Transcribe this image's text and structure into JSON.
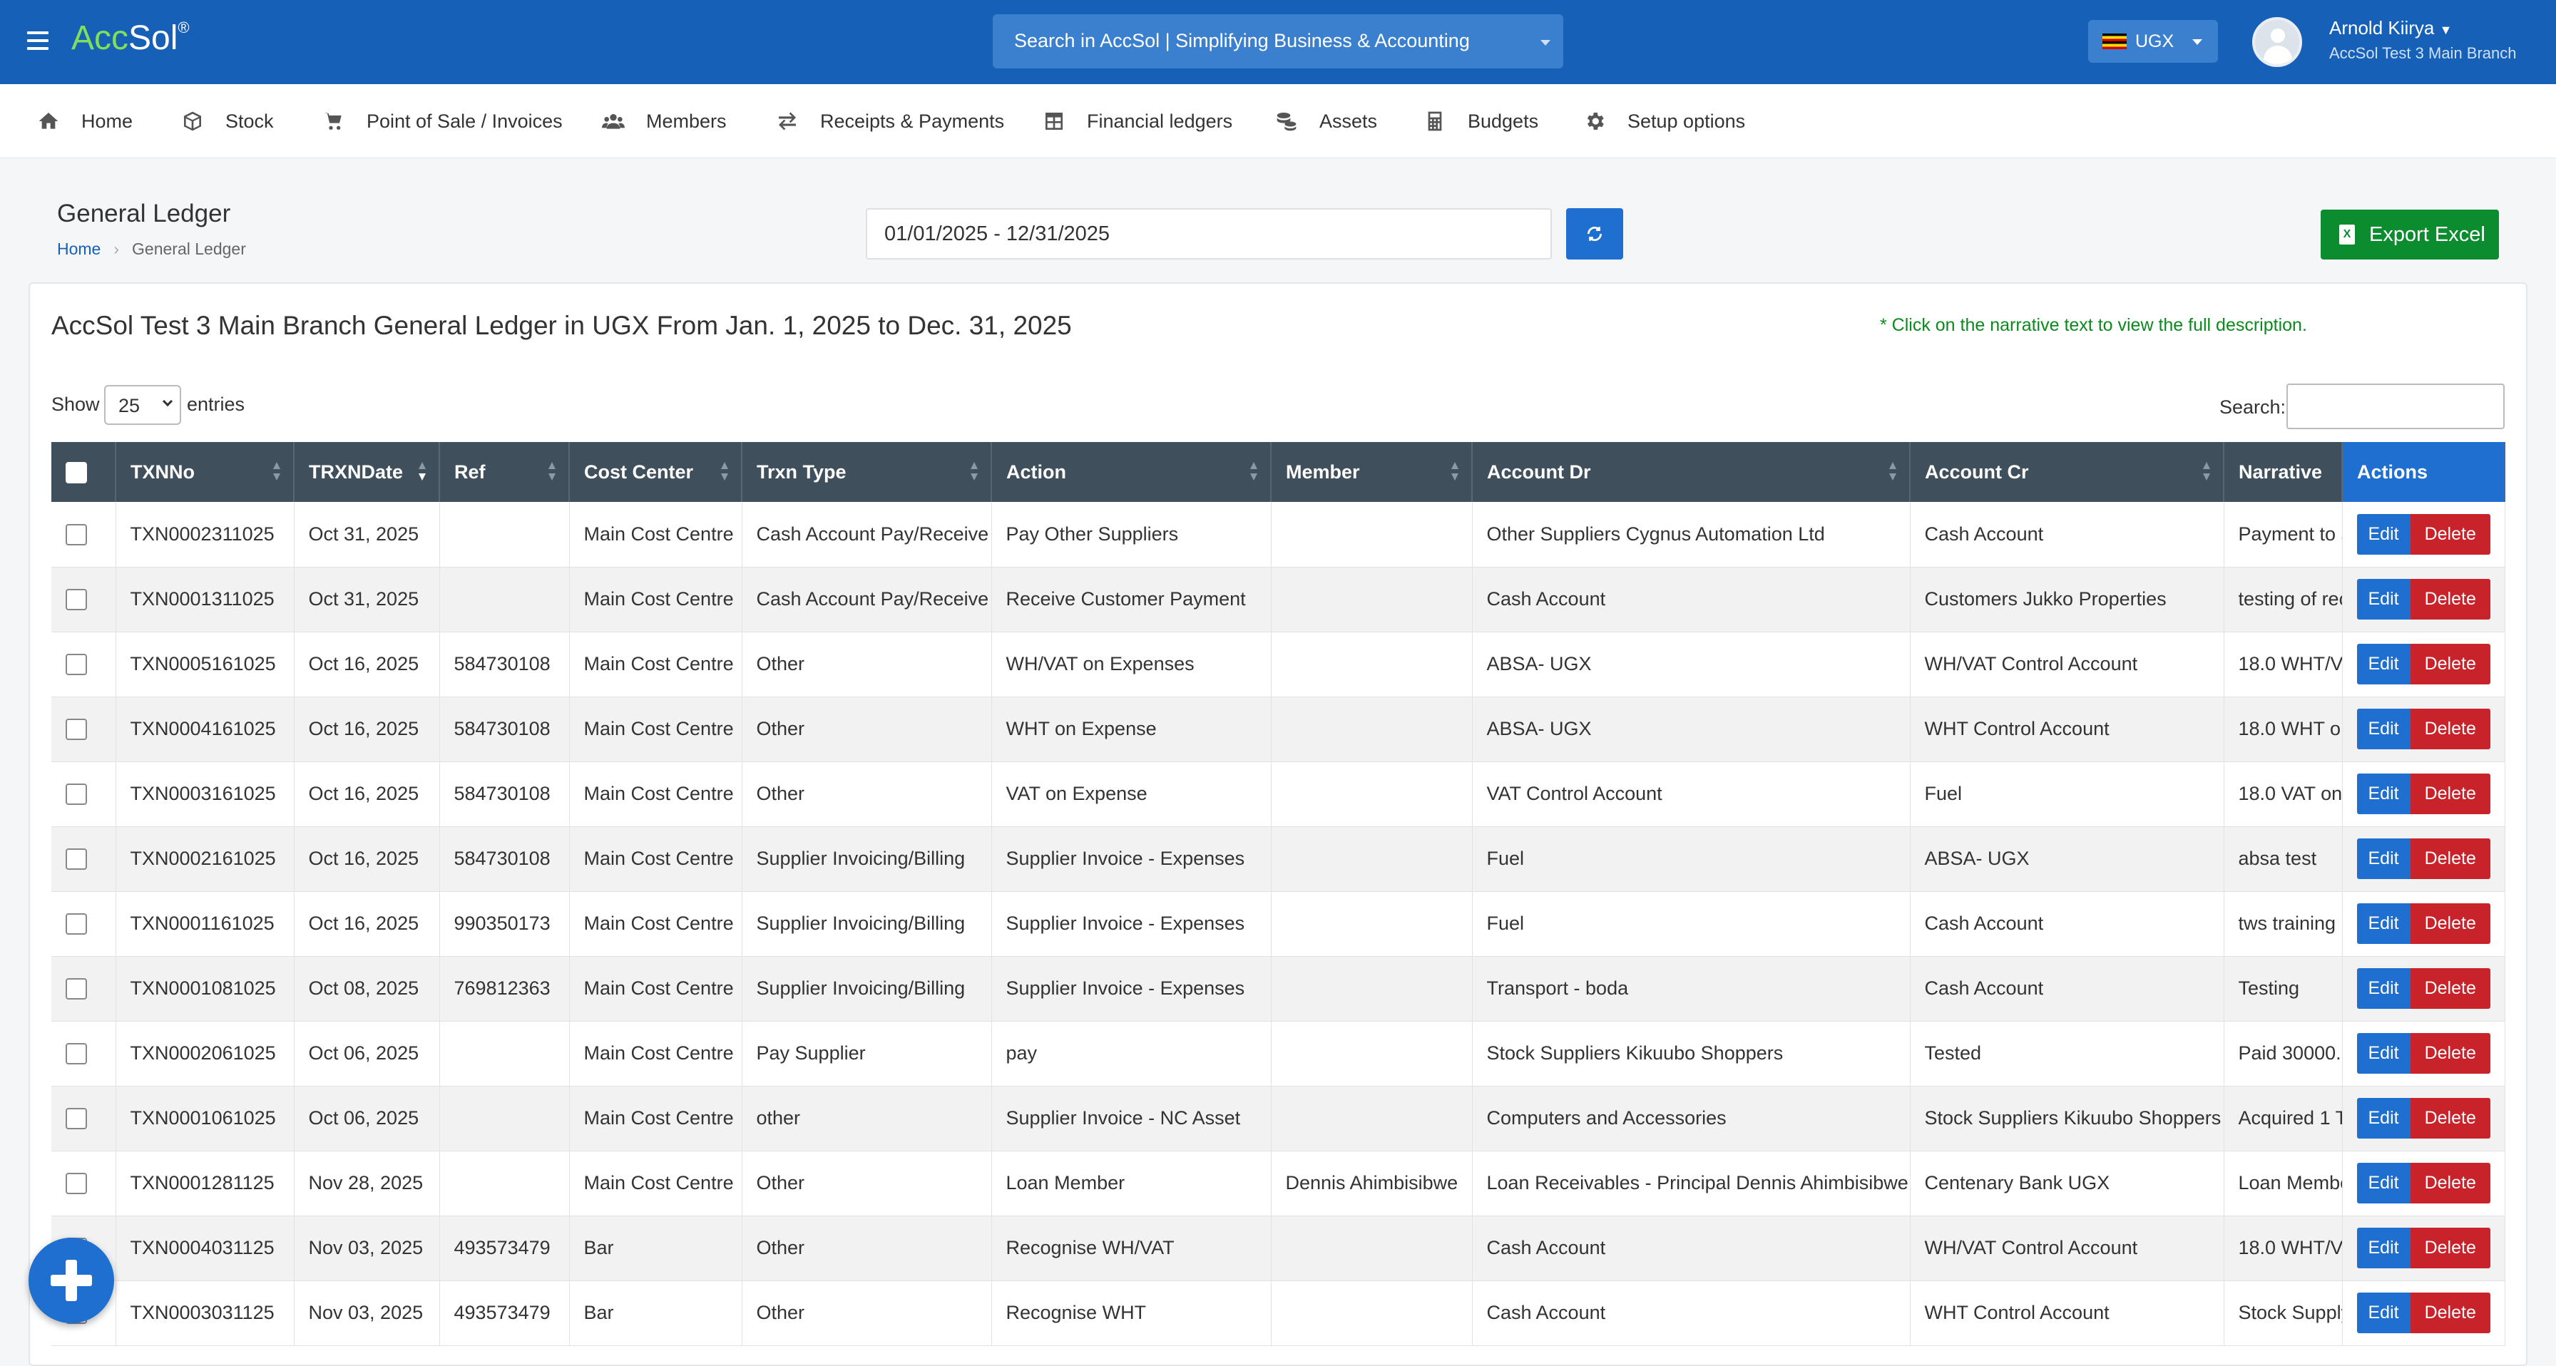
{
  "header": {
    "logo_left": "Acc",
    "logo_right": "Sol",
    "logo_mark": "®",
    "search_placeholder": "Search in AccSol | Simplifying Business & Accounting",
    "currency": "UGX",
    "user_name": "Arnold Kiirya",
    "user_branch": "AccSol Test 3 Main Branch"
  },
  "nav": [
    {
      "label": "Home",
      "icon": "home-icon"
    },
    {
      "label": "Stock",
      "icon": "box-icon"
    },
    {
      "label": "Point of Sale / Invoices",
      "icon": "cart-icon"
    },
    {
      "label": "Members",
      "icon": "users-icon"
    },
    {
      "label": "Receipts & Payments",
      "icon": "exchange-icon"
    },
    {
      "label": "Financial ledgers",
      "icon": "table-icon"
    },
    {
      "label": "Assets",
      "icon": "coins-icon"
    },
    {
      "label": "Budgets",
      "icon": "calculator-icon"
    },
    {
      "label": "Setup options",
      "icon": "gear-icon"
    }
  ],
  "page": {
    "title": "General Ledger",
    "breadcrumb_home": "Home",
    "breadcrumb_current": "General Ledger",
    "date_range": "01/01/2025 - 12/31/2025",
    "export_label": "Export Excel",
    "report_title": "AccSol Test 3 Main Branch General Ledger in UGX From Jan. 1, 2025 to Dec. 31, 2025",
    "hint": "* Click on the narrative text to view the full description.",
    "show_label": "Show",
    "entries_value": "25",
    "entries_label": "entries",
    "search_label": "Search:"
  },
  "table": {
    "columns": [
      "TXNNo",
      "TRXNDate",
      "Ref",
      "Cost Center",
      "Trxn Type",
      "Action",
      "Member",
      "Account Dr",
      "Account Cr",
      "Narrative",
      "Actions"
    ],
    "edit_label": "Edit",
    "delete_label": "Delete",
    "rows": [
      {
        "txn": "TXN0002311025",
        "date": "Oct 31, 2025",
        "ref": "",
        "cc": "Main Cost Centre",
        "type": "Cash Account Pay/Receive",
        "action": "Pay Other Suppliers",
        "member": "",
        "dr": "Other Suppliers Cygnus Automation Ltd",
        "cr": "Cash Account",
        "narr": "Payment to s"
      },
      {
        "txn": "TXN0001311025",
        "date": "Oct 31, 2025",
        "ref": "",
        "cc": "Main Cost Centre",
        "type": "Cash Account Pay/Receive",
        "action": "Receive Customer Payment",
        "member": "",
        "dr": "Cash Account",
        "cr": "Customers Jukko Properties",
        "narr": "testing of rec"
      },
      {
        "txn": "TXN0005161025",
        "date": "Oct 16, 2025",
        "ref": "584730108",
        "cc": "Main Cost Centre",
        "type": "Other",
        "action": "WH/VAT on Expenses",
        "member": "",
        "dr": "ABSA- UGX",
        "cr": "WH/VAT Control Account",
        "narr": "18.0 WHT/V"
      },
      {
        "txn": "TXN0004161025",
        "date": "Oct 16, 2025",
        "ref": "584730108",
        "cc": "Main Cost Centre",
        "type": "Other",
        "action": "WHT on Expense",
        "member": "",
        "dr": "ABSA- UGX",
        "cr": "WHT Control Account",
        "narr": "18.0 WHT o"
      },
      {
        "txn": "TXN0003161025",
        "date": "Oct 16, 2025",
        "ref": "584730108",
        "cc": "Main Cost Centre",
        "type": "Other",
        "action": "VAT on Expense",
        "member": "",
        "dr": "VAT Control Account",
        "cr": "Fuel",
        "narr": "18.0 VAT on"
      },
      {
        "txn": "TXN0002161025",
        "date": "Oct 16, 2025",
        "ref": "584730108",
        "cc": "Main Cost Centre",
        "type": "Supplier Invoicing/Billing",
        "action": "Supplier Invoice - Expenses",
        "member": "",
        "dr": "Fuel",
        "cr": "ABSA- UGX",
        "narr": "absa test"
      },
      {
        "txn": "TXN0001161025",
        "date": "Oct 16, 2025",
        "ref": "990350173",
        "cc": "Main Cost Centre",
        "type": "Supplier Invoicing/Billing",
        "action": "Supplier Invoice - Expenses",
        "member": "",
        "dr": "Fuel",
        "cr": "Cash Account",
        "narr": "tws training"
      },
      {
        "txn": "TXN0001081025",
        "date": "Oct 08, 2025",
        "ref": "769812363",
        "cc": "Main Cost Centre",
        "type": "Supplier Invoicing/Billing",
        "action": "Supplier Invoice - Expenses",
        "member": "",
        "dr": "Transport - boda",
        "cr": "Cash Account",
        "narr": "Testing"
      },
      {
        "txn": "TXN0002061025",
        "date": "Oct 06, 2025",
        "ref": "",
        "cc": "Main Cost Centre",
        "type": "Pay Supplier",
        "action": "pay",
        "member": "",
        "dr": "Stock Suppliers Kikuubo Shoppers",
        "cr": "Tested",
        "narr": "Paid 30000."
      },
      {
        "txn": "TXN0001061025",
        "date": "Oct 06, 2025",
        "ref": "",
        "cc": "Main Cost Centre",
        "type": "other",
        "action": "Supplier Invoice - NC Asset",
        "member": "",
        "dr": "Computers and Accessories",
        "cr": "Stock Suppliers Kikuubo Shoppers",
        "narr": "Acquired 1 T"
      },
      {
        "txn": "TXN0001281125",
        "date": "Nov 28, 2025",
        "ref": "",
        "cc": "Main Cost Centre",
        "type": "Other",
        "action": "Loan Member",
        "member": "Dennis Ahimbisibwe",
        "dr": "Loan Receivables - Principal Dennis Ahimbisibwe",
        "cr": "Centenary Bank UGX",
        "narr": "Loan Membe"
      },
      {
        "txn": "TXN0004031125",
        "date": "Nov 03, 2025",
        "ref": "493573479",
        "cc": "Bar",
        "type": "Other",
        "action": "Recognise WH/VAT",
        "member": "",
        "dr": "Cash Account",
        "cr": "WH/VAT Control Account",
        "narr": "18.0 WHT/V"
      },
      {
        "txn": "TXN0003031125",
        "date": "Nov 03, 2025",
        "ref": "493573479",
        "cc": "Bar",
        "type": "Other",
        "action": "Recognise WHT",
        "member": "",
        "dr": "Cash Account",
        "cr": "WHT Control Account",
        "narr": "Stock Supply"
      }
    ]
  }
}
